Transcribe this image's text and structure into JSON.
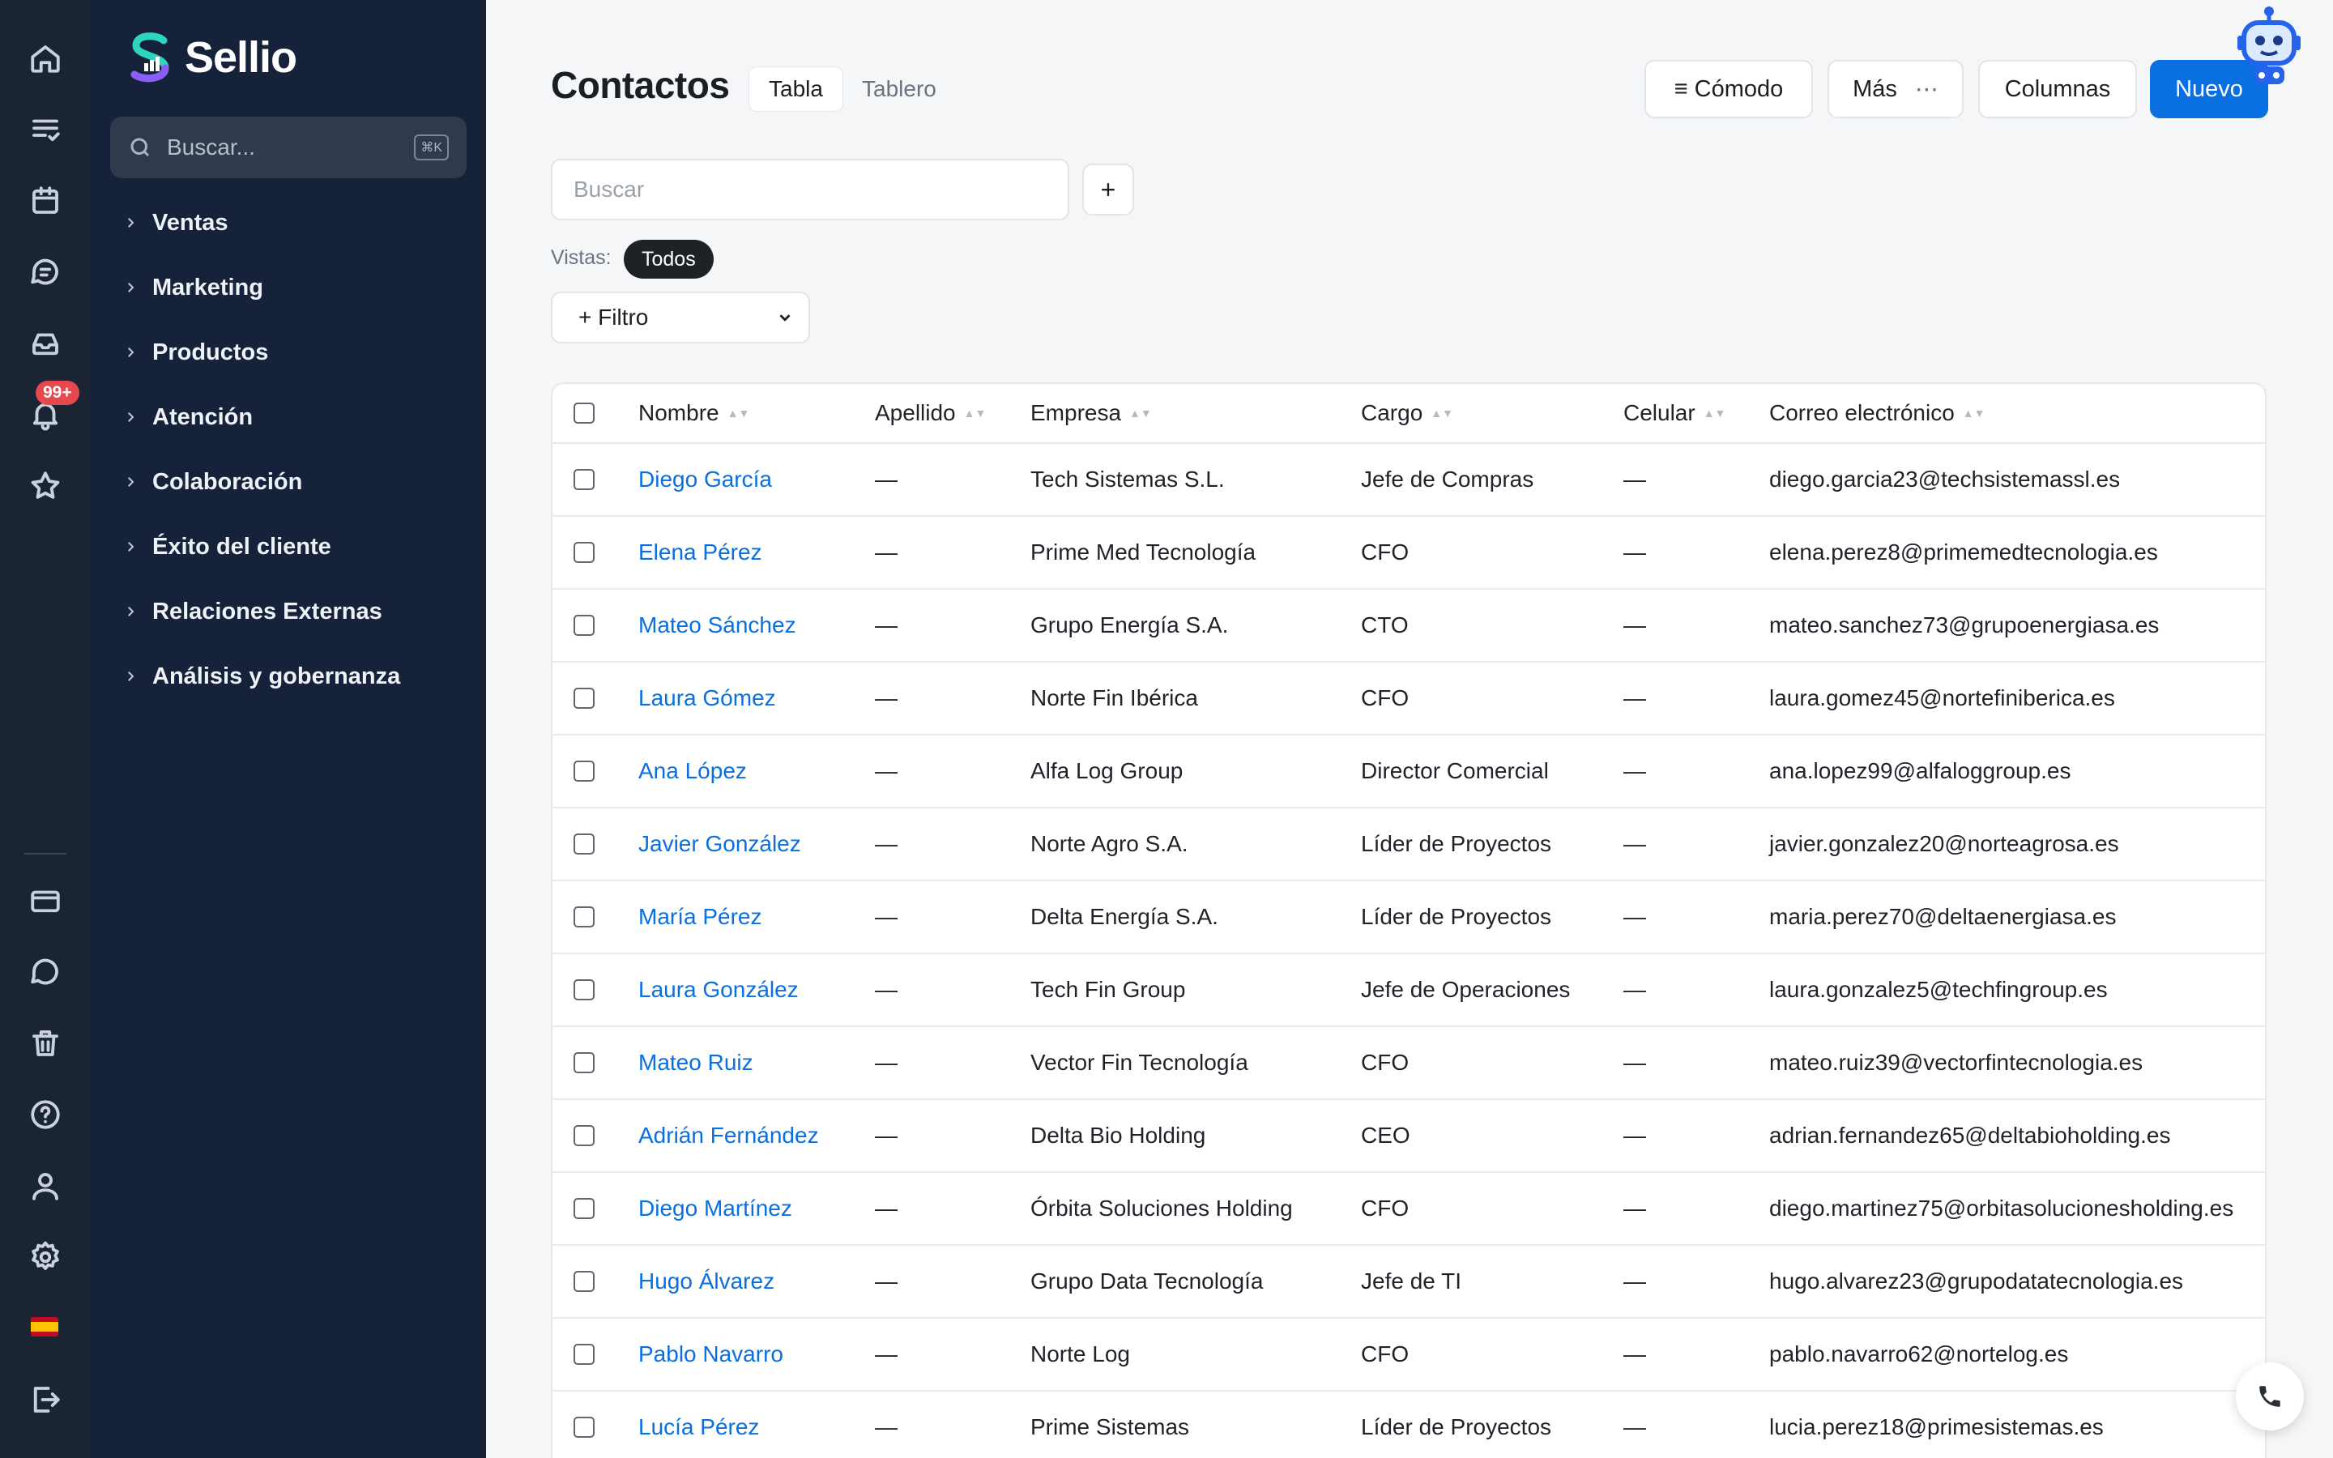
{
  "brand": {
    "name": "Sellio"
  },
  "rail": {
    "badge": "99+",
    "icons": [
      "home-icon",
      "tasks-icon",
      "calendar-icon",
      "chat-icon",
      "inbox-icon",
      "bell-icon",
      "star-icon",
      "billing-icon",
      "comment-icon",
      "trash-icon",
      "help-icon",
      "user-icon",
      "settings-icon",
      "flag-es-icon",
      "logout-icon"
    ]
  },
  "nav": {
    "search_placeholder": "Buscar...",
    "shortcut": "⌘K",
    "items": [
      "Ventas",
      "Marketing",
      "Productos",
      "Atención",
      "Colaboración",
      "Éxito del cliente",
      "Relaciones Externas",
      "Análisis y gobernanza"
    ]
  },
  "header": {
    "title": "Contactos",
    "tabs": [
      "Tabla",
      "Tablero"
    ],
    "density_label": "≡ Cómodo",
    "more_label": "Más",
    "more_icon": "⋯",
    "columns_label": "Columnas",
    "new_label": "Nuevo"
  },
  "search": {
    "placeholder": "Buscar",
    "add_label": "+"
  },
  "views": {
    "label": "Vistas:",
    "active": "Todos"
  },
  "filter": {
    "label": "+ Filtro"
  },
  "table": {
    "columns": [
      "Nombre",
      "Apellido",
      "Empresa",
      "Cargo",
      "Celular",
      "Correo electrónico"
    ],
    "rows": [
      [
        "Diego García",
        "—",
        "Tech Sistemas S.L.",
        "Jefe de Compras",
        "—",
        "diego.garcia23@techsistemassl.es"
      ],
      [
        "Elena Pérez",
        "—",
        "Prime Med Tecnología",
        "CFO",
        "—",
        "elena.perez8@primemedtecnologia.es"
      ],
      [
        "Mateo Sánchez",
        "—",
        "Grupo Energía S.A.",
        "CTO",
        "—",
        "mateo.sanchez73@grupoenergiasa.es"
      ],
      [
        "Laura Gómez",
        "—",
        "Norte Fin Ibérica",
        "CFO",
        "—",
        "laura.gomez45@nortefiniberica.es"
      ],
      [
        "Ana López",
        "—",
        "Alfa Log Group",
        "Director Comercial",
        "—",
        "ana.lopez99@alfaloggroup.es"
      ],
      [
        "Javier González",
        "—",
        "Norte Agro S.A.",
        "Líder de Proyectos",
        "—",
        "javier.gonzalez20@norteagrosa.es"
      ],
      [
        "María Pérez",
        "—",
        "Delta Energía S.A.",
        "Líder de Proyectos",
        "—",
        "maria.perez70@deltaenergiasa.es"
      ],
      [
        "Laura González",
        "—",
        "Tech Fin Group",
        "Jefe de Operaciones",
        "—",
        "laura.gonzalez5@techfingroup.es"
      ],
      [
        "Mateo Ruiz",
        "—",
        "Vector Fin Tecnología",
        "CFO",
        "—",
        "mateo.ruiz39@vectorfintecnologia.es"
      ],
      [
        "Adrián Fernández",
        "—",
        "Delta Bio Holding",
        "CEO",
        "—",
        "adrian.fernandez65@deltabioholding.es"
      ],
      [
        "Diego Martínez",
        "—",
        "Órbita Soluciones Holding",
        "CFO",
        "—",
        "diego.martinez75@orbitasolucionesholding.es"
      ],
      [
        "Hugo Álvarez",
        "—",
        "Grupo Data Tecnología",
        "Jefe de TI",
        "—",
        "hugo.alvarez23@grupodatatecnologia.es"
      ],
      [
        "Pablo Navarro",
        "—",
        "Norte Log",
        "CFO",
        "—",
        "pablo.navarro62@nortelog.es"
      ],
      [
        "Lucía Pérez",
        "—",
        "Prime Sistemas",
        "Líder de Proyectos",
        "—",
        "lucia.perez18@primesistemas.es"
      ]
    ]
  },
  "colors": {
    "accent": "#0a6fe0",
    "sidebar": "#16213a",
    "rail": "#1a2433",
    "badge": "#e5484d"
  }
}
